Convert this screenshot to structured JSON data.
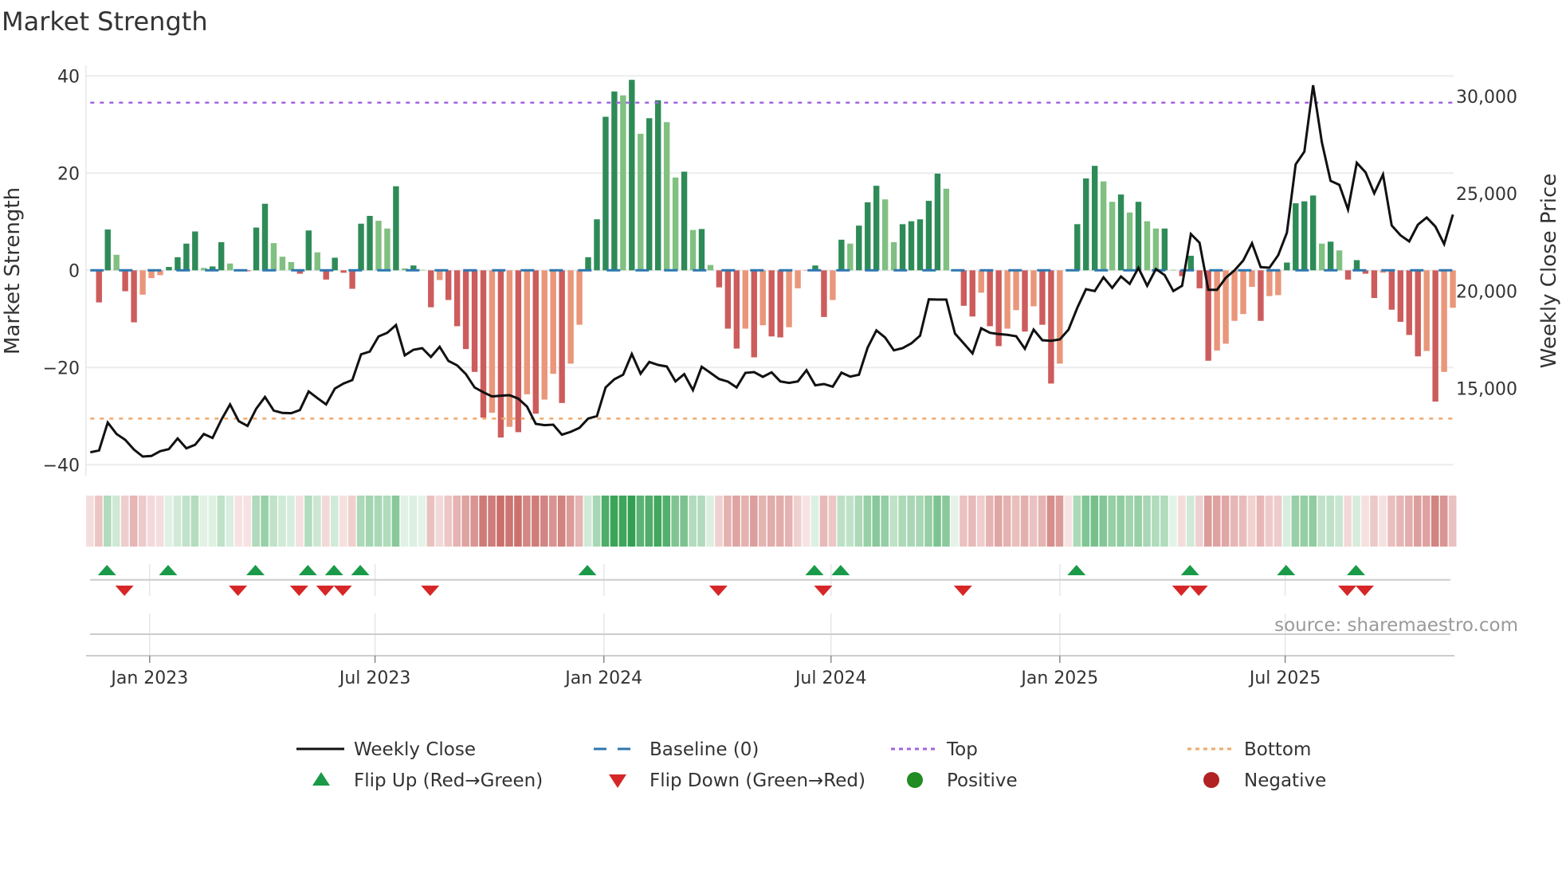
{
  "title": "Market Strength",
  "source": "source: sharemaestro.com",
  "chart_data": {
    "type": "bar+line",
    "title": "Market Strength",
    "ylabel": "Market Strength",
    "y2label": "Weekly Close Price",
    "x_unit": "week index",
    "ylim": [
      -40,
      40
    ],
    "y2lim": [
      11080,
      31050
    ],
    "grid": true,
    "yticks": [
      {
        "value": 40,
        "label": "40"
      },
      {
        "value": 20,
        "label": "20"
      },
      {
        "value": 0,
        "label": "0"
      },
      {
        "value": -20,
        "label": "−20"
      },
      {
        "value": -40,
        "label": "−40"
      }
    ],
    "y2ticks": [
      {
        "value": 30000,
        "label": "30,000"
      },
      {
        "value": 25000,
        "label": "25,000"
      },
      {
        "value": 20000,
        "label": "20,000"
      },
      {
        "value": 15000,
        "label": "15,000"
      }
    ],
    "xticks": [
      {
        "week": 6.8,
        "label": "Jan 2023"
      },
      {
        "week": 32.6,
        "label": "Jul 2023"
      },
      {
        "week": 58.8,
        "label": "Jan 2024"
      },
      {
        "week": 84.8,
        "label": "Jul 2024"
      },
      {
        "week": 111.0,
        "label": "Jan 2025"
      },
      {
        "week": 136.8,
        "label": "Jul 2025"
      }
    ],
    "top_level": 34.5,
    "bottom_level": -30.5,
    "baseline": 0,
    "strength": [
      null,
      -6.6,
      8.4,
      3.2,
      -4.3,
      -10.7,
      -5.0,
      -1.6,
      -1.0,
      0.7,
      2.7,
      5.5,
      8.0,
      0.5,
      0.8,
      5.8,
      1.4,
      -0.2,
      -0.2,
      8.8,
      13.7,
      5.6,
      2.8,
      1.7,
      -0.7,
      8.2,
      3.7,
      -1.9,
      2.6,
      -0.5,
      -3.8,
      9.6,
      11.2,
      10.2,
      8.6,
      17.3,
      0.4,
      1.0,
      0.1,
      -7.6,
      -2.0,
      -6.1,
      -11.5,
      -16.2,
      -20.9,
      -30.3,
      -29.3,
      -34.4,
      -32.2,
      -33.3,
      -25.5,
      -29.5,
      -26.6,
      -21.3,
      -27.3,
      -19.2,
      -11.2,
      2.7,
      10.5,
      31.6,
      36.8,
      36.0,
      39.2,
      28.1,
      31.3,
      35.0,
      30.5,
      19.1,
      20.3,
      8.3,
      8.5,
      1.1,
      -3.5,
      -12.0,
      -16.1,
      -12.0,
      -17.9,
      -11.3,
      -13.6,
      -13.8,
      -11.7,
      -3.7,
      -0.1,
      1.0,
      -9.6,
      -6.1,
      6.3,
      5.5,
      9.2,
      14.0,
      17.4,
      14.6,
      5.8,
      9.5,
      10.1,
      10.5,
      14.3,
      19.9,
      16.8,
      0.1,
      -7.3,
      -9.5,
      -4.6,
      -11.5,
      -15.6,
      -12.0,
      -8.2,
      -12.6,
      -7.4,
      -11.2,
      -23.3,
      -19.2,
      -0.1,
      9.5,
      18.9,
      21.5,
      18.3,
      14.1,
      15.6,
      11.9,
      14.1,
      10.1,
      8.6,
      8.6,
      0.1,
      -1.2,
      3.0,
      -3.7,
      -18.6,
      -16.5,
      -15.1,
      -10.4,
      -9.0,
      -3.4,
      -10.4,
      -5.3,
      -5.1,
      1.6,
      13.8,
      14.2,
      15.4,
      5.5,
      5.9,
      4.1,
      -1.9,
      2.1,
      -0.7,
      -5.7,
      -0.5,
      -8.1,
      -10.6,
      -13.3,
      -17.7,
      -16.6,
      -27.0,
      -20.9,
      -7.7
    ],
    "weekly_close": [
      11720,
      11816,
      13248,
      12661,
      12362,
      11857,
      11502,
      11530,
      11775,
      11884,
      12430,
      11925,
      12102,
      12661,
      12457,
      13385,
      14176,
      13316,
      13071,
      13957,
      14557,
      13862,
      13739,
      13726,
      13889,
      14844,
      14503,
      14176,
      14994,
      15253,
      15430,
      16753,
      16890,
      17667,
      17858,
      18254,
      16699,
      16985,
      17067,
      16617,
      17135,
      16412,
      16181,
      15731,
      15049,
      14803,
      14585,
      14626,
      14653,
      14476,
      14067,
      13180,
      13112,
      13139,
      12621,
      12771,
      12975,
      13453,
      13576,
      15049,
      15471,
      15703,
      16767,
      15758,
      16358,
      16208,
      16126,
      15362,
      15731,
      14912,
      16113,
      15799,
      15485,
      15349,
      15049,
      15799,
      15840,
      15594,
      15826,
      15362,
      15281,
      15362,
      15935,
      15158,
      15226,
      15090,
      15812,
      15608,
      15703,
      17095,
      17981,
      17613,
      16958,
      17067,
      17313,
      17708,
      19577,
      19563,
      19563,
      17818,
      17313,
      16795,
      18090,
      17858,
      17790,
      17749,
      17681,
      17040,
      18022,
      17477,
      17449,
      17518,
      18022,
      19141,
      20095,
      20000,
      20709,
      20164,
      20750,
      20368,
      21187,
      20273,
      21132,
      20818,
      20000,
      20273,
      22933,
      22482,
      20068,
      20068,
      20682,
      21064,
      21569,
      22455,
      21228,
      21200,
      21841,
      23001,
      26506,
      27161,
      30571,
      27638,
      25661,
      25456,
      24187,
      26588,
      26097,
      25020,
      25988,
      23369,
      22864,
      22551,
      23410,
      23778,
      23315,
      22414,
      23928
    ],
    "flip_up_weeks": [
      2,
      9,
      19,
      25,
      28,
      31,
      57,
      83,
      86,
      113,
      126,
      137,
      145
    ],
    "flip_down_weeks": [
      4,
      17,
      24,
      27,
      29,
      39,
      72,
      84,
      100,
      125,
      127,
      144,
      146
    ],
    "legend": {
      "placement": "bottom-center",
      "weekly_close": "Weekly Close",
      "baseline": "Baseline (0)",
      "top": "Top",
      "bottom": "Bottom",
      "flip_up": "Flip Up (Red→Green)",
      "flip_down": "Flip Down (Green→Red)",
      "positive": "Positive",
      "negative": "Negative"
    },
    "colors": {
      "pos_strong": "#2e8b57",
      "pos_weak": "#80c080",
      "neg_strong": "#cd5c5c",
      "neg_weak": "#e9967a",
      "baseline": "#2c77b0",
      "top": "#a064e0",
      "bottom": "#f0a868",
      "line": "#111111",
      "flip_up": "#1a9a48",
      "flip_down": "#d62728",
      "positive": "#228b22",
      "negative": "#b22222"
    }
  }
}
